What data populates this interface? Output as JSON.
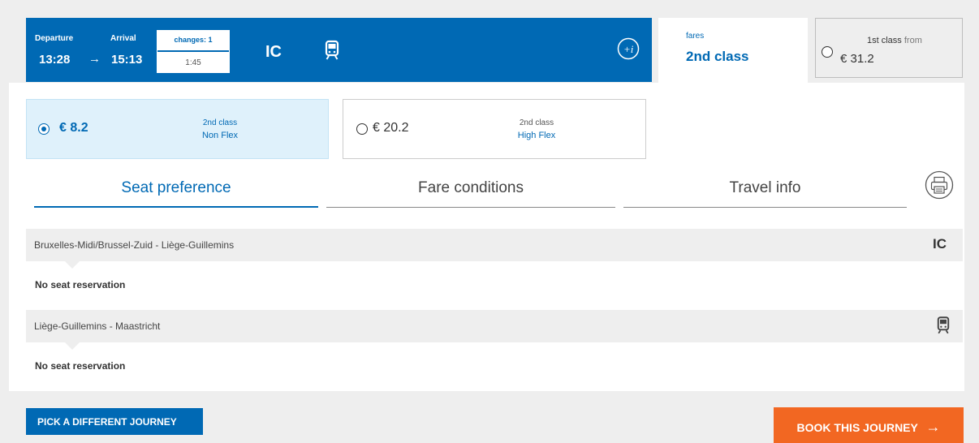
{
  "journey": {
    "departure_label": "Departure",
    "departure_time": "13:28",
    "arrow": "→",
    "arrival_label": "Arrival",
    "arrival_time": "15:13",
    "changes_label": "changes: 1",
    "duration": "1:45",
    "train_type": "IC",
    "icons": [
      "train-icon",
      "info-icon"
    ]
  },
  "fare_tabs": {
    "active_small": "fares",
    "active_label": "2nd class",
    "first_class_label": "1st class",
    "first_class_from": "from",
    "first_class_price": "€ 31.2"
  },
  "options": [
    {
      "price": "€ 8.2",
      "class": "2nd class",
      "flex": "Non Flex",
      "selected": true
    },
    {
      "price": "€ 20.2",
      "class": "2nd class",
      "flex": "High Flex",
      "selected": false
    }
  ],
  "tabs": [
    {
      "label": "Seat preference",
      "active": true
    },
    {
      "label": "Fare conditions",
      "active": false
    },
    {
      "label": "Travel info",
      "active": false
    }
  ],
  "segments": [
    {
      "route": "Bruxelles-Midi/Brussel-Zuid - Liège-Guillemins",
      "train": "IC",
      "seat": "No seat reservation"
    },
    {
      "route": "Liège-Guillemins - Maastricht",
      "train_icon": "train-icon",
      "seat": "No seat reservation"
    }
  ],
  "buttons": {
    "pick_different": "PICK A DIFFERENT JOURNEY",
    "book": "BOOK THIS JOURNEY",
    "book_arrow": "→"
  },
  "colors": {
    "primary": "#0069b4",
    "accent": "#f26722",
    "selected_bg": "#dff1fb"
  }
}
